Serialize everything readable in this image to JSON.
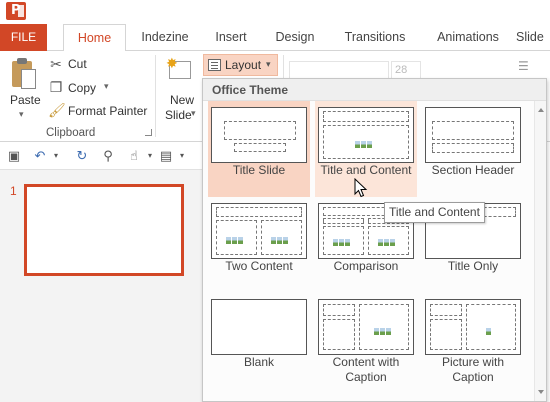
{
  "app": {
    "icon": "powerpoint-icon"
  },
  "tabs": [
    {
      "label": "FILE"
    },
    {
      "label": "Home"
    },
    {
      "label": "Indezine"
    },
    {
      "label": "Insert"
    },
    {
      "label": "Design"
    },
    {
      "label": "Transitions"
    },
    {
      "label": "Animations"
    },
    {
      "label": "Slide"
    }
  ],
  "ribbon": {
    "paste_label": "Paste",
    "cut_label": "Cut",
    "copy_label": "Copy",
    "format_painter_label": "Format Painter",
    "clipboard_group": "Clipboard",
    "new_slide_line1": "New",
    "new_slide_line2": "Slide",
    "layout_label": "Layout",
    "font_size": "28"
  },
  "slides": [
    {
      "number": "1"
    }
  ],
  "layout_menu": {
    "header": "Office Theme",
    "items": [
      {
        "label": "Title Slide",
        "state": "selected"
      },
      {
        "label": "Title and Content",
        "state": "hover"
      },
      {
        "label": "Section Header"
      },
      {
        "label": "Two Content"
      },
      {
        "label": "Comparison"
      },
      {
        "label": "Title Only"
      },
      {
        "label": "Blank"
      },
      {
        "label": "Content with Caption"
      },
      {
        "label": "Picture with Caption"
      }
    ]
  },
  "tooltip": {
    "text": "Title and Content"
  },
  "colors": {
    "accent": "#d24726",
    "selected": "#f9d4c3",
    "hover": "#fce5d9"
  }
}
